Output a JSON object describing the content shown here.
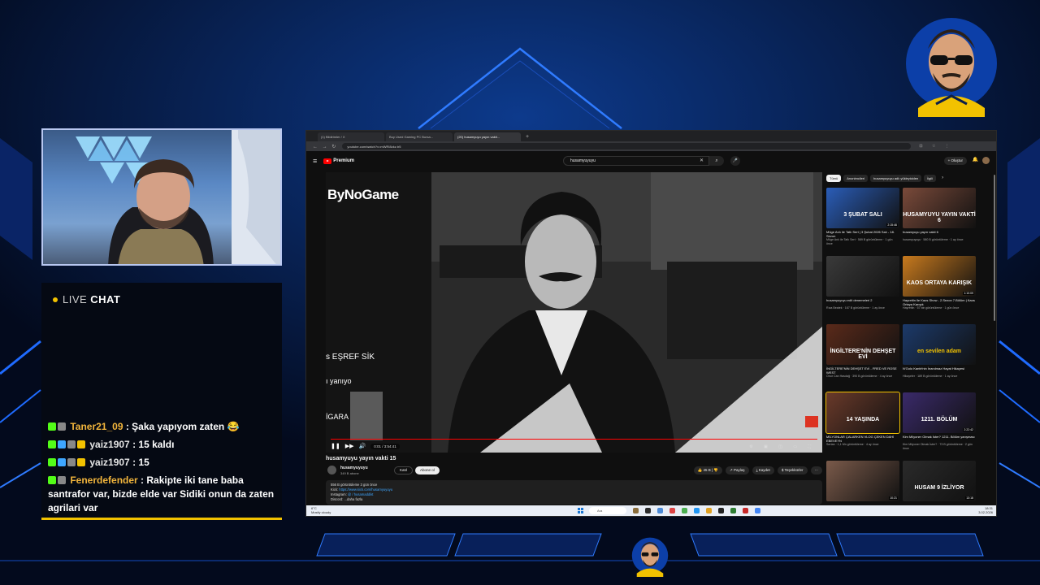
{
  "chat": {
    "header_live": "LIVE",
    "header_chat": "CHAT",
    "messages": [
      {
        "user": "Taner21_09",
        "sep": " : ",
        "text": "Şaka yapıyom zaten 😂"
      },
      {
        "user": "yaiz1907",
        "sep": " : ",
        "text": "15 kaldı"
      },
      {
        "user": "yaiz1907",
        "sep": " : ",
        "text": "15"
      },
      {
        "user": "Fenerdefender",
        "sep": " : ",
        "text": "Rakipte iki tane baba santrafor var, bizde elde var Sidiki onun da zaten agrilari var"
      }
    ]
  },
  "browser": {
    "tabs": [
      "(1) Bildirimler / X",
      "Buy Used Gaming PC Bursa...",
      "(20) husamyuyu yayın vakti..."
    ],
    "tab_plus": "+",
    "url": "youtube.com/watch?v=mWRI8zkz.tr5",
    "nav_glyphs": "← → ↻",
    "addr_icons": "⊡ ☆ ⋮"
  },
  "youtube": {
    "logo": "Premium",
    "search_value": "husamyuyuyu",
    "create_label": "+ Oluştur",
    "menu_glyph": "≡",
    "bell_glyph": "🔔",
    "search_x": "✕",
    "search_glyph": "⌕",
    "mic_glyph": "🎤",
    "video": {
      "brand_overlay": "ByNoGame",
      "overlay_line1": "s EŞREF SİK",
      "overlay_line2": "ı yanıyo",
      "overlay_line3": "İGARA",
      "time": "0:01 / 3:54:41",
      "progress": 1.0,
      "play_glyph": "❚❚",
      "next_glyph": "▶▶",
      "volume_glyph": "🔊",
      "right_controls": "⚙ ▣ ◫ ▭ ⛶"
    },
    "title": "husamyuyu yayın vakti 15",
    "channel": {
      "name": "husamyuyuyu",
      "subs": "349 B abone",
      "join_label": "Katıl",
      "subscribe_label": "Abone ol"
    },
    "actions": [
      "👍 45 B  |  👎",
      "↗ Paylaş",
      "⤓ Kaydet",
      "$ Teşekkürler",
      "⋯"
    ],
    "description": {
      "line1": "556 B görüntüleme  3 gün önce",
      "line2_label": "Kick:",
      "line2_link": "https://www.kick.com/husamyuyuyu",
      "line3_label": "Instagram:",
      "line3_link": "@ / husamaddikt",
      "line4": "Discord: ...daha fazla"
    },
    "chips": [
      "Tümü",
      "Anonimcileri",
      "husamyuyuyu adlı yükleyiciden",
      "İlgili",
      "›"
    ],
    "recommendations": [
      {
        "title": "Müge Anlı ile Tatlı Sert | 3 Şubat 2026 Salı - 18. Sezon",
        "meta": "Müge Anlı ile Tatlı Sert · 589 B görüntüleme · 1 gün önce",
        "duration": "2:15:46",
        "big": "3 ŞUBAT SALI",
        "color": "#2a5db8"
      },
      {
        "title": "husamyuyu yayın vakti 6",
        "meta": "husamyuyuyu · 580 B görüntüleme · 1 ay önce",
        "duration": "",
        "big": "HUSAMYUYU YAYIN VAKTİ 6",
        "color": "#7a4a3a"
      },
      {
        "title": "husamyuyuyu edit denemeleri 2",
        "meta": "Rıza Beatek · 167 B görüntüleme · 1 ay önce",
        "duration": "",
        "big": "",
        "color": "#3a3a3a"
      },
      {
        "title": "Hayrettin ile Kaos Show - 2.Sezon 7.Bölüm | Kaos Ortaya Karışık",
        "meta": "Hayrettin · 57 bin görüntüleme · 1 gün önce",
        "duration": "1:10:09",
        "big": "KAOS ORTAYA KARIŞIK",
        "color": "#c87a1e"
      },
      {
        "title": "İNGİLTERE'NİN DEHŞET EVİ - FRED VE ROSE WEST",
        "meta": "Onur Can Hasdağ · 390 B görüntüleme · 4 ay önce",
        "duration": "",
        "big": "İNGİLTERE'NİN DEHŞET EVİ",
        "color": "#5a2a1a"
      },
      {
        "title": "N'Golo Kanté'nin İnanılmaz Hayat Hikayesi",
        "meta": "Hikayeler · 189 B görüntüleme · 1 ay önce",
        "duration": "",
        "big": "en sevilen adam",
        "color": "#1c3a6a"
      },
      {
        "title": "MİLYONLAR ÇALARKEN VLOG ÇEKEN DAHİ EBEVEYN",
        "meta": "Sertan · 1,1 Mn görüntüleme · 4 ay önce",
        "duration": "",
        "big": "14 YAŞINDA",
        "color": "#6a3a2a"
      },
      {
        "title": "Kim Milyoner Olmak İster? 1211. Bölüm yarışması",
        "meta": "Kim Milyoner Olmak İster? · 73 B görüntüleme · 2 gün önce",
        "duration": "2:22:42",
        "big": "1211. BÖLÜM",
        "color": "#3a2a6a"
      },
      {
        "title": "",
        "meta": "",
        "duration": "10:21",
        "big": "",
        "color": "#7a5a4a"
      },
      {
        "title": "",
        "meta": "",
        "duration": "13:18",
        "big": "HUSAM 9 İZLİYOR",
        "color": "#2a2a2a"
      }
    ]
  },
  "taskbar": {
    "weather_temp": "6°C",
    "weather_desc": "Mostly cloudy",
    "search": "Ara",
    "time": "18:31",
    "date": "3.02.2026",
    "icons": [
      "#8a6d3b",
      "#2c2c2c",
      "#4c8ad6",
      "#d44",
      "#4caf50",
      "#2196f3",
      "#e0a020",
      "#222",
      "#2e7d32",
      "#c62828",
      "#4285f4"
    ]
  },
  "colors": {
    "chat_user": "#f2b53c",
    "accent_yellow": "#f2c200",
    "yt_red": "#ff0000",
    "bg_blue": "#040d24"
  }
}
